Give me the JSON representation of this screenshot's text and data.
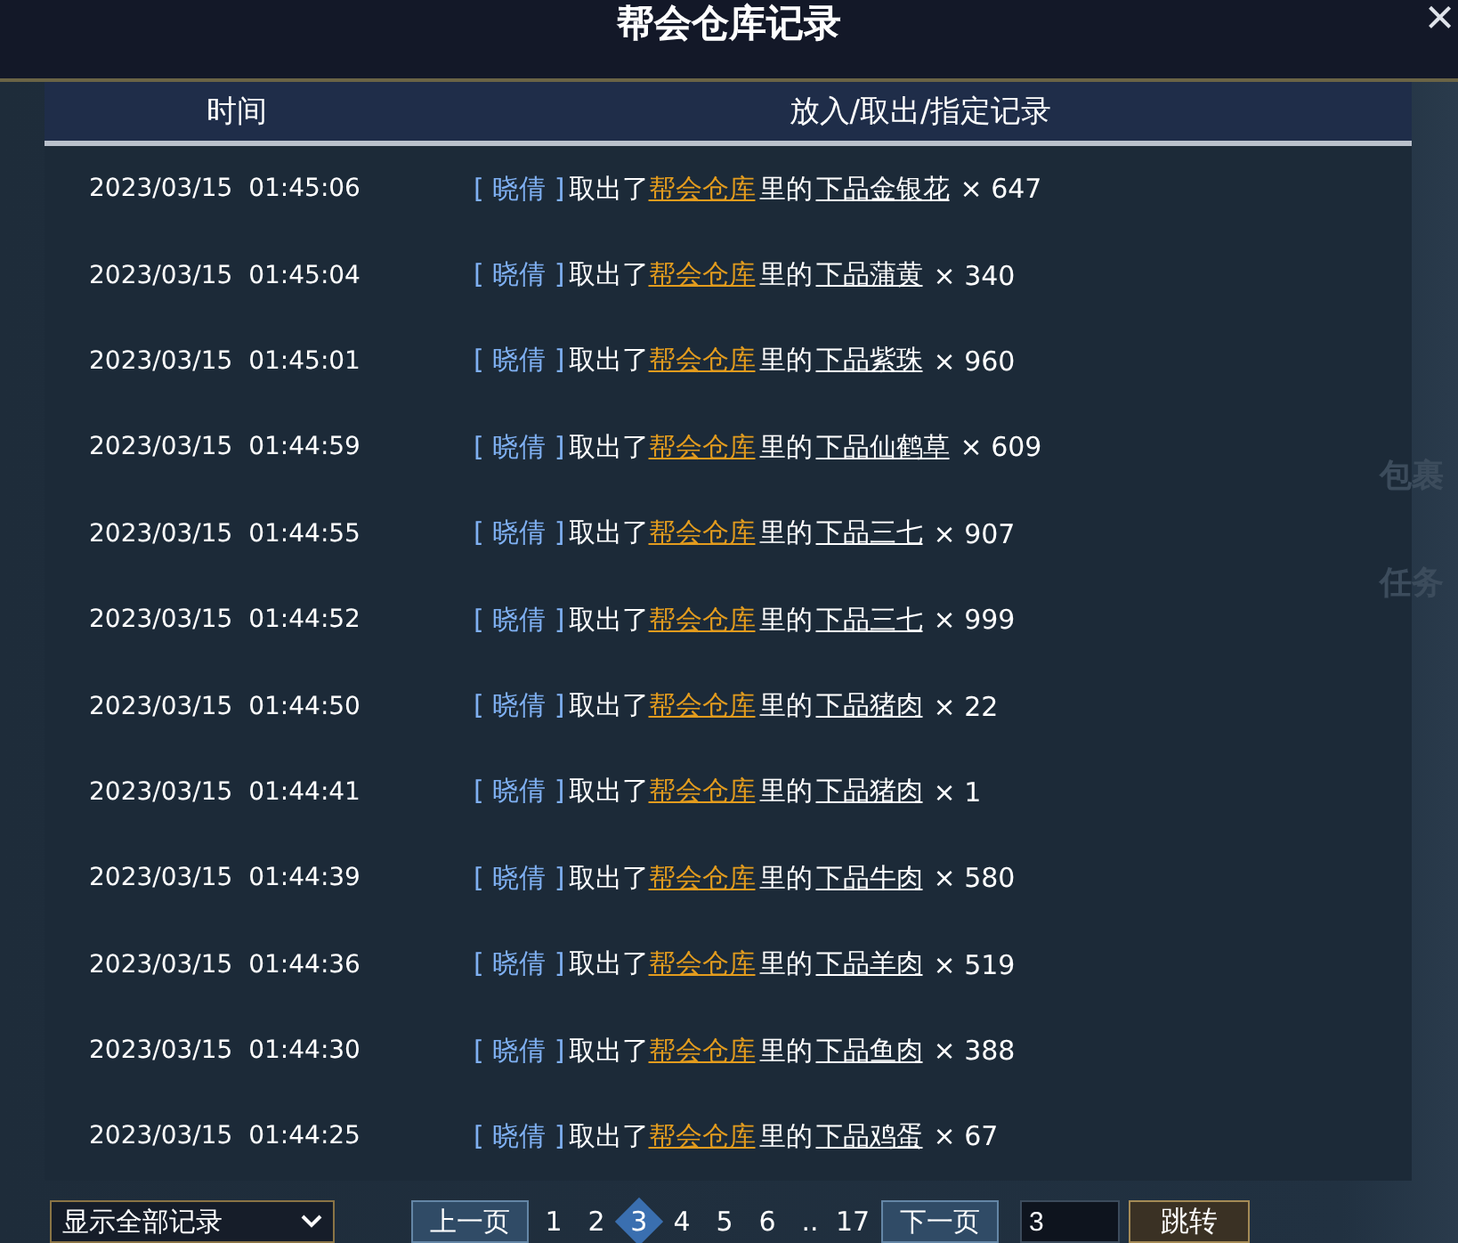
{
  "window": {
    "title": "帮会仓库记录",
    "close": "×"
  },
  "table": {
    "columns": [
      "时间",
      "放入/取出/指定记录"
    ],
    "rows": [
      {
        "time": "2023/03/15  01:45:06",
        "player": "[ 晓倩 ]",
        "action": "取出了",
        "place": "帮会仓库",
        "connector": "里的",
        "item": "下品金银花",
        "count": "× 647"
      },
      {
        "time": "2023/03/15  01:45:04",
        "player": "[ 晓倩 ]",
        "action": "取出了",
        "place": "帮会仓库",
        "connector": "里的",
        "item": "下品蒲黄",
        "count": "× 340"
      },
      {
        "time": "2023/03/15  01:45:01",
        "player": "[ 晓倩 ]",
        "action": "取出了",
        "place": "帮会仓库",
        "connector": "里的",
        "item": "下品紫珠",
        "count": "× 960"
      },
      {
        "time": "2023/03/15  01:44:59",
        "player": "[ 晓倩 ]",
        "action": "取出了",
        "place": "帮会仓库",
        "connector": "里的",
        "item": "下品仙鹤草",
        "count": "× 609"
      },
      {
        "time": "2023/03/15  01:44:55",
        "player": "[ 晓倩 ]",
        "action": "取出了",
        "place": "帮会仓库",
        "connector": "里的",
        "item": "下品三七",
        "count": "× 907"
      },
      {
        "time": "2023/03/15  01:44:52",
        "player": "[ 晓倩 ]",
        "action": "取出了",
        "place": "帮会仓库",
        "connector": "里的",
        "item": "下品三七",
        "count": "× 999"
      },
      {
        "time": "2023/03/15  01:44:50",
        "player": "[ 晓倩 ]",
        "action": "取出了",
        "place": "帮会仓库",
        "connector": "里的",
        "item": "下品猪肉",
        "count": "× 22"
      },
      {
        "time": "2023/03/15  01:44:41",
        "player": "[ 晓倩 ]",
        "action": "取出了",
        "place": "帮会仓库",
        "connector": "里的",
        "item": "下品猪肉",
        "count": "× 1"
      },
      {
        "time": "2023/03/15  01:44:39",
        "player": "[ 晓倩 ]",
        "action": "取出了",
        "place": "帮会仓库",
        "connector": "里的",
        "item": "下品牛肉",
        "count": "× 580"
      },
      {
        "time": "2023/03/15  01:44:36",
        "player": "[ 晓倩 ]",
        "action": "取出了",
        "place": "帮会仓库",
        "connector": "里的",
        "item": "下品羊肉",
        "count": "× 519"
      },
      {
        "time": "2023/03/15  01:44:30",
        "player": "[ 晓倩 ]",
        "action": "取出了",
        "place": "帮会仓库",
        "connector": "里的",
        "item": "下品鱼肉",
        "count": "× 388"
      },
      {
        "time": "2023/03/15  01:44:25",
        "player": "[ 晓倩 ]",
        "action": "取出了",
        "place": "帮会仓库",
        "connector": "里的",
        "item": "下品鸡蛋",
        "count": "× 67"
      }
    ]
  },
  "side_tabs": [
    "包裹",
    "任务"
  ],
  "footer": {
    "filter": "显示全部记录",
    "prev": "上一页",
    "next": "下一页",
    "pages": [
      {
        "label": "1",
        "selected": false
      },
      {
        "label": "2",
        "selected": false
      },
      {
        "label": "3",
        "selected": true
      },
      {
        "label": "4",
        "selected": false
      },
      {
        "label": "5",
        "selected": false
      },
      {
        "label": "6",
        "selected": false
      },
      {
        "label": "..",
        "selected": false
      },
      {
        "label": "17",
        "selected": false
      }
    ],
    "page_input": "3",
    "jump": "跳转"
  }
}
